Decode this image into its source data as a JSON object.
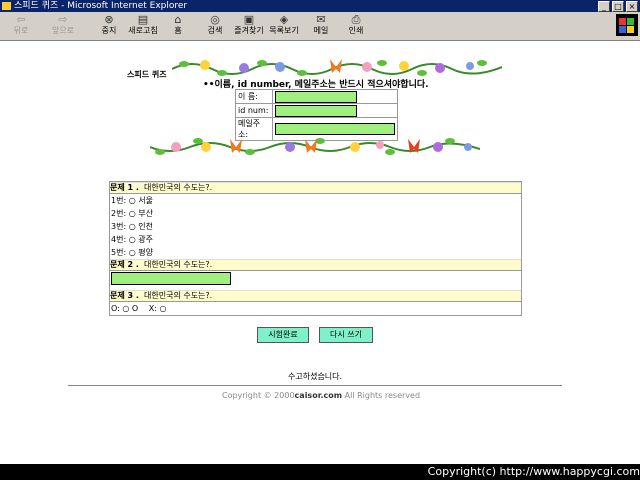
{
  "window": {
    "title": "스피드 퀴즈 - Microsoft Internet Explorer"
  },
  "toolbar": {
    "back": "뒤로",
    "forward": "앞으로",
    "stop": "중지",
    "refresh": "새로고침",
    "home": "홈",
    "search": "검색",
    "favorites": "즐겨찾기",
    "history": "목록보기",
    "mail": "메일",
    "print": "인쇄"
  },
  "page": {
    "quiz_title": "스피드 퀴즈",
    "notice": "••이름, id number, 메일주소는 반드시 적으셔야합니다.",
    "form": {
      "name_label": "이 름:",
      "id_label": "id num:",
      "email_label": "메일주소:"
    },
    "questions": [
      {
        "label": "문제 1 .",
        "text": "대한민국의 수도는?.",
        "options": [
          "1번: ○ 서울",
          "2번: ○ 부산",
          "3번: ○ 인천",
          "4번: ○ 광주",
          "5번: ○ 평양"
        ]
      },
      {
        "label": "문제 2 .",
        "text": "대한민국의 수도는?."
      },
      {
        "label": "문제 3 .",
        "text": "대한민국의 수도는?.",
        "ox_o": "O: ○ O",
        "ox_x": "X: ○"
      }
    ],
    "submit_label": "시험완료",
    "reset_label": "다시 쓰기",
    "thanks": "수고하셨습니다.",
    "copyright_prefix": "Copyright © 2000",
    "copyright_domain": "caisor.com",
    "copyright_suffix": " All Rights reserved"
  },
  "watermark": "Copyright(c) http://www.happycgi.com",
  "colors": {
    "input_fill": "#a0f080",
    "question_header": "#fffccc",
    "button_fill": "#7ff0c8",
    "titlebar": "#0a246a"
  }
}
